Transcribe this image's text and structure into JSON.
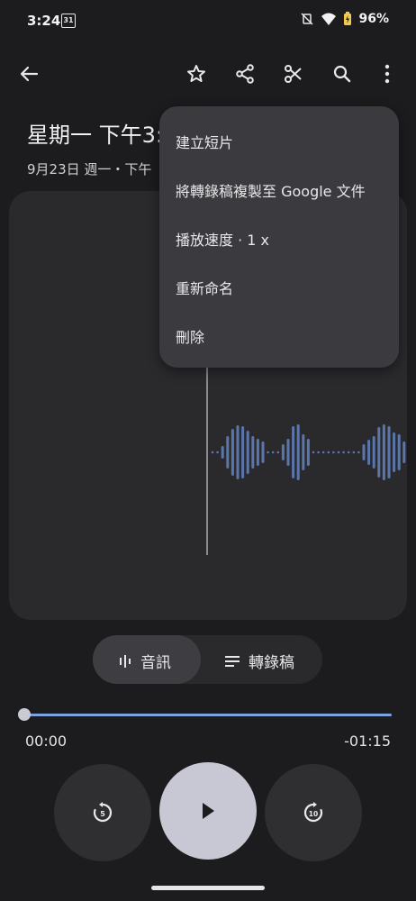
{
  "status_bar": {
    "time": "3:24",
    "calendar_day": "31",
    "battery": "96%"
  },
  "recording": {
    "title": "星期一 下午3:",
    "subtitle": "9月23日 週一・下午"
  },
  "menu": {
    "items": [
      {
        "label": "建立短片"
      },
      {
        "label": "將轉錄稿複製至 Google 文件"
      },
      {
        "label": "播放速度 · 1 x"
      },
      {
        "label": "重新命名"
      },
      {
        "label": "刪除"
      }
    ]
  },
  "toggle": {
    "audio_label": "音訊",
    "transcript_label": "轉錄稿",
    "selected": "audio"
  },
  "player": {
    "elapsed": "00:00",
    "remaining": "-01:15",
    "progress": 0.0,
    "rewind_seconds": "5",
    "forward_seconds": "10"
  },
  "colors": {
    "accent": "#7fa3e0",
    "waveform": "#5b76ab",
    "background": "#1c1c1e",
    "menu": "#3b3b3f"
  }
}
